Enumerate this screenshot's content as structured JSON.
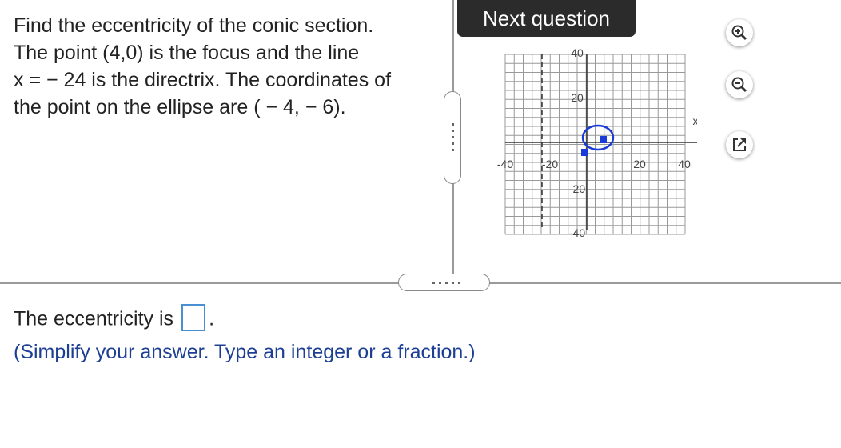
{
  "question": {
    "lines": [
      "Find the eccentricity of the conic section.",
      "The point (4,0) is the focus and the line",
      "x = − 24 is the directrix. The coordinates of",
      "the point on the ellipse are ( − 4, − 6)."
    ]
  },
  "next_button": {
    "label": "Next question"
  },
  "graph": {
    "x_axis_label": "x",
    "x_ticks": [
      "-40",
      "-20",
      "20",
      "40"
    ],
    "y_ticks": [
      "40",
      "20",
      "-20",
      "-40"
    ],
    "range": [
      -50,
      50
    ]
  },
  "tools": {
    "zoom_in": "zoom-in-icon",
    "zoom_out": "zoom-out-icon",
    "popout": "popout-icon"
  },
  "answer": {
    "prefix": "The eccentricity is",
    "suffix": ".",
    "value": ""
  },
  "hint": "(Simplify your answer. Type an integer or a fraction.)"
}
